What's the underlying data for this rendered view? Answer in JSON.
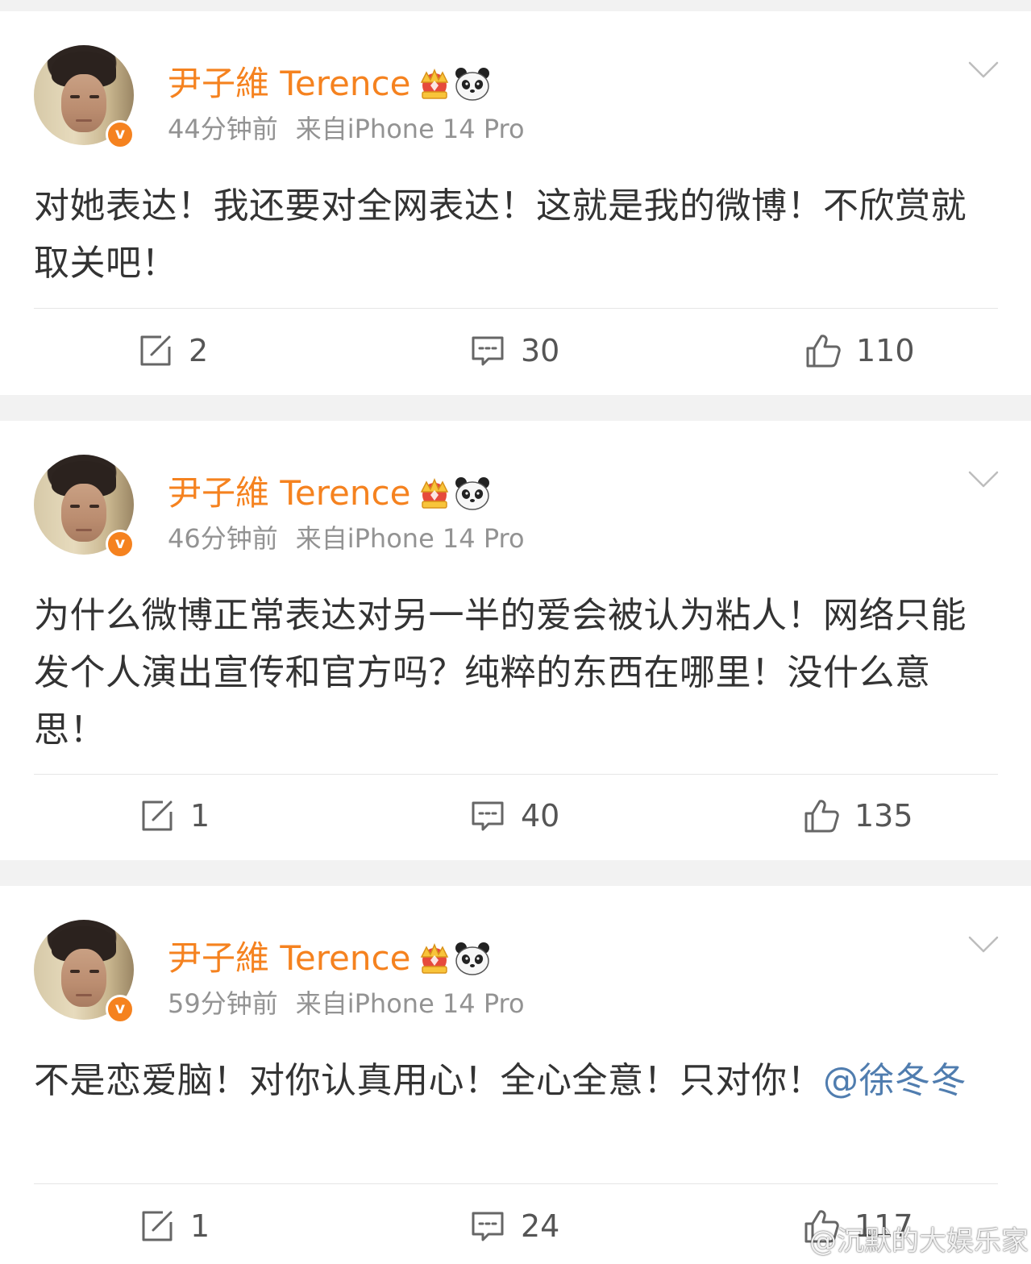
{
  "posts": [
    {
      "author": "尹子維 Terence",
      "verified_mark": "v",
      "time": "44分钟前",
      "source": "来自iPhone 14 Pro",
      "text": "对她表达！我还要对全网表达！这就是我的微博！不欣赏就取关吧！",
      "mention": "",
      "reposts": "2",
      "comments": "30",
      "likes": "110"
    },
    {
      "author": "尹子維 Terence",
      "verified_mark": "v",
      "time": "46分钟前",
      "source": "来自iPhone 14 Pro",
      "text": "为什么微博正常表达对另一半的爱会被认为粘人！网络只能发个人演出宣传和官方吗？纯粹的东西在哪里！没什么意思！",
      "mention": "",
      "reposts": "1",
      "comments": "40",
      "likes": "135"
    },
    {
      "author": "尹子維 Terence",
      "verified_mark": "v",
      "time": "59分钟前",
      "source": "来自iPhone 14 Pro",
      "text": "不是恋爱脑！对你认真用心！全心全意！只对你！",
      "mention": "@徐冬冬",
      "reposts": "1",
      "comments": "24",
      "likes": "117"
    }
  ],
  "watermark": "@沉默的大娱乐家",
  "icons": {
    "verified": "verified-badge-icon",
    "crown": "crown-icon",
    "panda": "panda-icon",
    "menu": "chevron-down-icon",
    "repost": "repost-icon",
    "comment": "comment-icon",
    "like": "thumbs-up-icon",
    "watermark": "weibo-logo-icon"
  },
  "colors": {
    "username": "#f5821f",
    "meta": "#939393",
    "text": "#333333",
    "mention": "#507daf",
    "action": "#555555",
    "verified": "#f5821f",
    "background": "#f2f2f2"
  }
}
